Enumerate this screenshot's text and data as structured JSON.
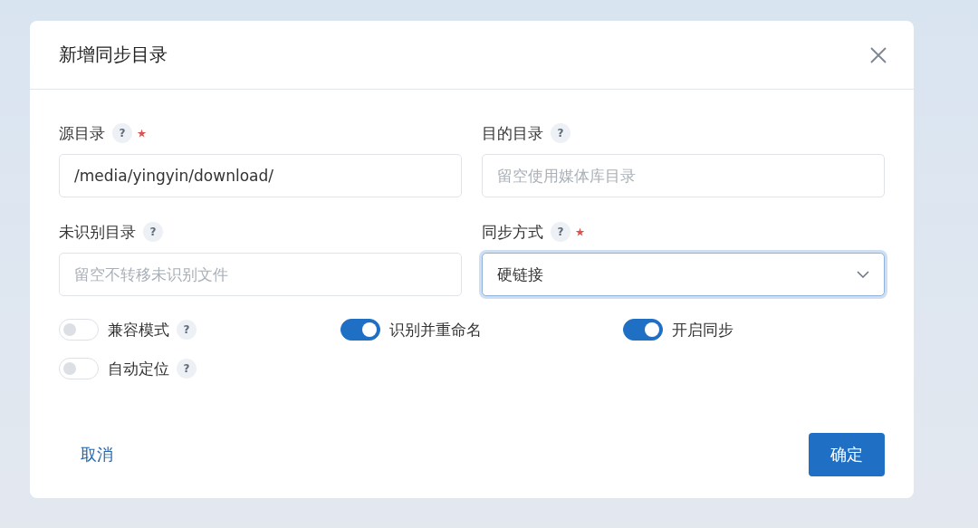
{
  "dialog": {
    "title": "新增同步目录",
    "fields": [
      {
        "label": "源目录",
        "help": "?",
        "required": true,
        "kind": "text",
        "value": "/media/yingyin/download/"
      },
      {
        "label": "目的目录",
        "help": "?",
        "required": false,
        "kind": "text",
        "placeholder": "留空使用媒体库目录"
      },
      {
        "label": "未识别目录",
        "help": "?",
        "required": false,
        "kind": "text",
        "placeholder": "留空不转移未识别文件"
      },
      {
        "label": "同步方式",
        "help": "?",
        "required": true,
        "kind": "select",
        "value": "硬链接",
        "focused": true
      }
    ],
    "switches": [
      {
        "label": "兼容模式",
        "help": "?",
        "on": false
      },
      {
        "label": "识别并重命名",
        "on": true
      },
      {
        "label": "开启同步",
        "on": true
      },
      {
        "label": "自动定位",
        "help": "?",
        "on": false
      }
    ],
    "cancel": "取消",
    "confirm": "确定"
  }
}
